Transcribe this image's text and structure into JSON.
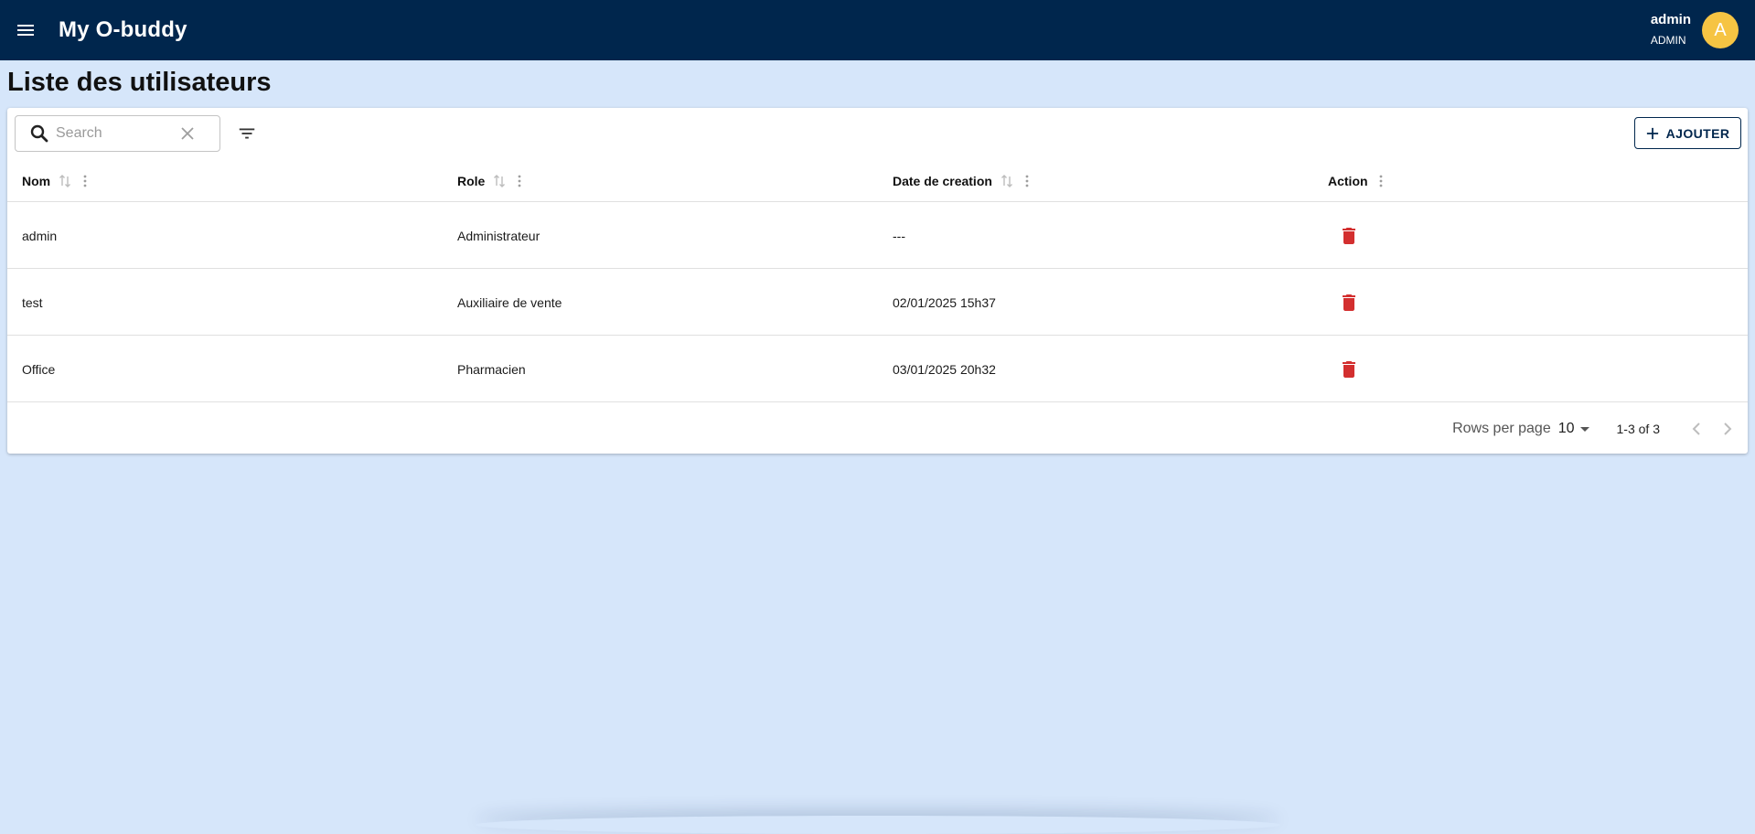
{
  "app": {
    "title": "My O-buddy",
    "user_name": "admin",
    "user_role": "ADMIN",
    "avatar_letter": "A"
  },
  "page": {
    "title": "Liste des utilisateurs"
  },
  "toolbar": {
    "search_placeholder": "Search",
    "add_label": "AJOUTER"
  },
  "table": {
    "columns": [
      "Nom",
      "Role",
      "Date de creation",
      "Action"
    ],
    "rows": [
      {
        "nom": "admin",
        "role": "Administrateur",
        "date": "---"
      },
      {
        "nom": "test",
        "role": "Auxiliaire de vente",
        "date": "02/01/2025 15h37"
      },
      {
        "nom": "Office",
        "role": "Pharmacien",
        "date": "03/01/2025 20h32"
      }
    ]
  },
  "pagination": {
    "rows_per_page_label": "Rows per page",
    "rows_per_page_value": "10",
    "range": "1-3 of 3"
  },
  "colors": {
    "appbar": "#00264d",
    "background": "#d6e6fa",
    "avatar": "#f6c443",
    "delete": "#d32f2f"
  }
}
